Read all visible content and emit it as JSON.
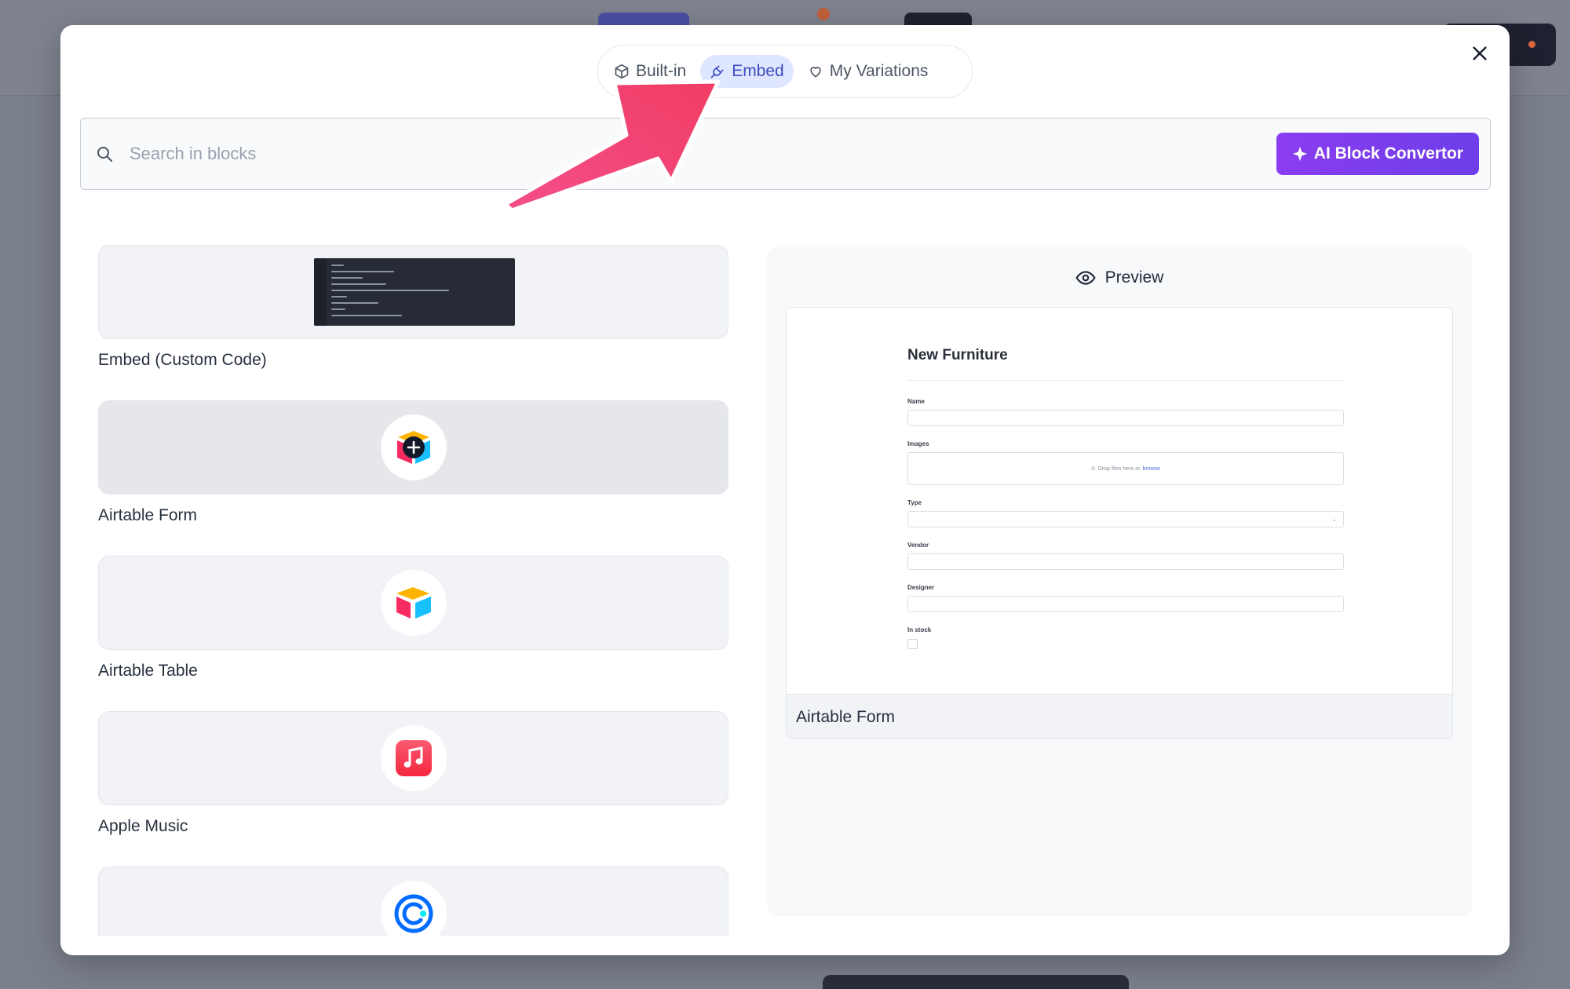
{
  "tabs": [
    {
      "label": "Built-in",
      "icon": "box-icon",
      "active": false
    },
    {
      "label": "Embed",
      "icon": "plug-icon",
      "active": true
    },
    {
      "label": "My Variations",
      "icon": "heart-icon",
      "active": false
    }
  ],
  "search": {
    "placeholder": "Search in blocks"
  },
  "ai_button": {
    "label": "AI Block Convertor",
    "icon": "sparkle-icon"
  },
  "blocks": [
    {
      "label": "Embed (Custom Code)",
      "thumb": "code-snippet"
    },
    {
      "label": "Airtable Form",
      "icon": "airtable-add-icon"
    },
    {
      "label": "Airtable Table",
      "icon": "airtable-icon"
    },
    {
      "label": "Apple Music",
      "icon": "apple-music-icon"
    },
    {
      "label": "",
      "icon": "calendly-icon"
    }
  ],
  "preview": {
    "heading": "Preview",
    "caption": "Airtable Form",
    "form": {
      "title": "New Furniture",
      "fields": [
        "Name",
        "Images",
        "Type",
        "Vendor",
        "Designer",
        "In stock"
      ],
      "drop_text": "Drop files here or",
      "drop_link": "browse"
    }
  },
  "colors": {
    "accent": "#6d3ee8",
    "active_tab_bg": "#dfe6ff",
    "annotation_arrow": "#f0457a"
  }
}
